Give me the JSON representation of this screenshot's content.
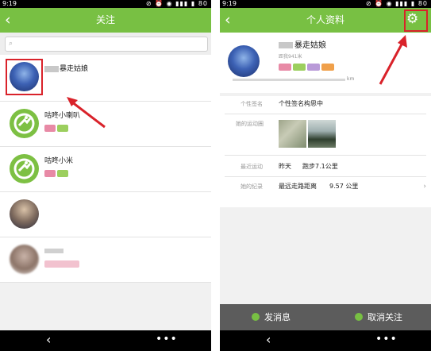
{
  "left_screen": {
    "status": {
      "time": "9:19",
      "battery": "80",
      "icons": "⊘ ⏰ ◉ ▮▮▮ ▮"
    },
    "title": "关注",
    "back_glyph": "‹",
    "search": {
      "icon": "⌕",
      "placeholder": ""
    },
    "contacts": [
      {
        "name": "暴走姑娘",
        "name_prefix": "",
        "selected": true
      },
      {
        "name": "咕咚小喇叭",
        "name_prefix": "",
        "selected": false
      },
      {
        "name": "咕咚小米",
        "name_prefix": "",
        "selected": false
      },
      {
        "name": "",
        "name_prefix": "",
        "selected": false
      },
      {
        "name": "",
        "name_prefix": "",
        "selected": false
      }
    ],
    "nav": {
      "back": "‹",
      "more": "•••"
    }
  },
  "right_screen": {
    "status": {
      "time": "9:19",
      "battery": "80",
      "icons": "⊘ ⏰ ◉ ▮▮▮ ▮"
    },
    "title": "个人资料",
    "back_glyph": "‹",
    "settings_icon": "⚙",
    "profile": {
      "name": "暴走姑娘",
      "subtext": "距我941米",
      "distance_unit": "km"
    },
    "signature": {
      "label": "个性签名",
      "value": "个性签名构思中"
    },
    "sport_circle": {
      "label": "她的运动圈"
    },
    "recent_sport": {
      "label": "最近运动",
      "day": "昨天",
      "value": "跑步7.1公里"
    },
    "records": {
      "label": "她的纪录",
      "title": "最远走路距离",
      "value": "9.57 公里",
      "chevron": "›"
    },
    "actions": {
      "message": "发消息",
      "unfollow": "取消关注"
    },
    "nav": {
      "back": "‹",
      "more": "•••"
    }
  },
  "colors": {
    "brand_green": "#78c043",
    "highlight_red": "#d9222a",
    "action_bar": "#5c5c5c"
  },
  "icons": [
    "back-arrow-icon",
    "search-icon",
    "gear-icon",
    "more-icon",
    "wifi-icon",
    "battery-icon"
  ]
}
